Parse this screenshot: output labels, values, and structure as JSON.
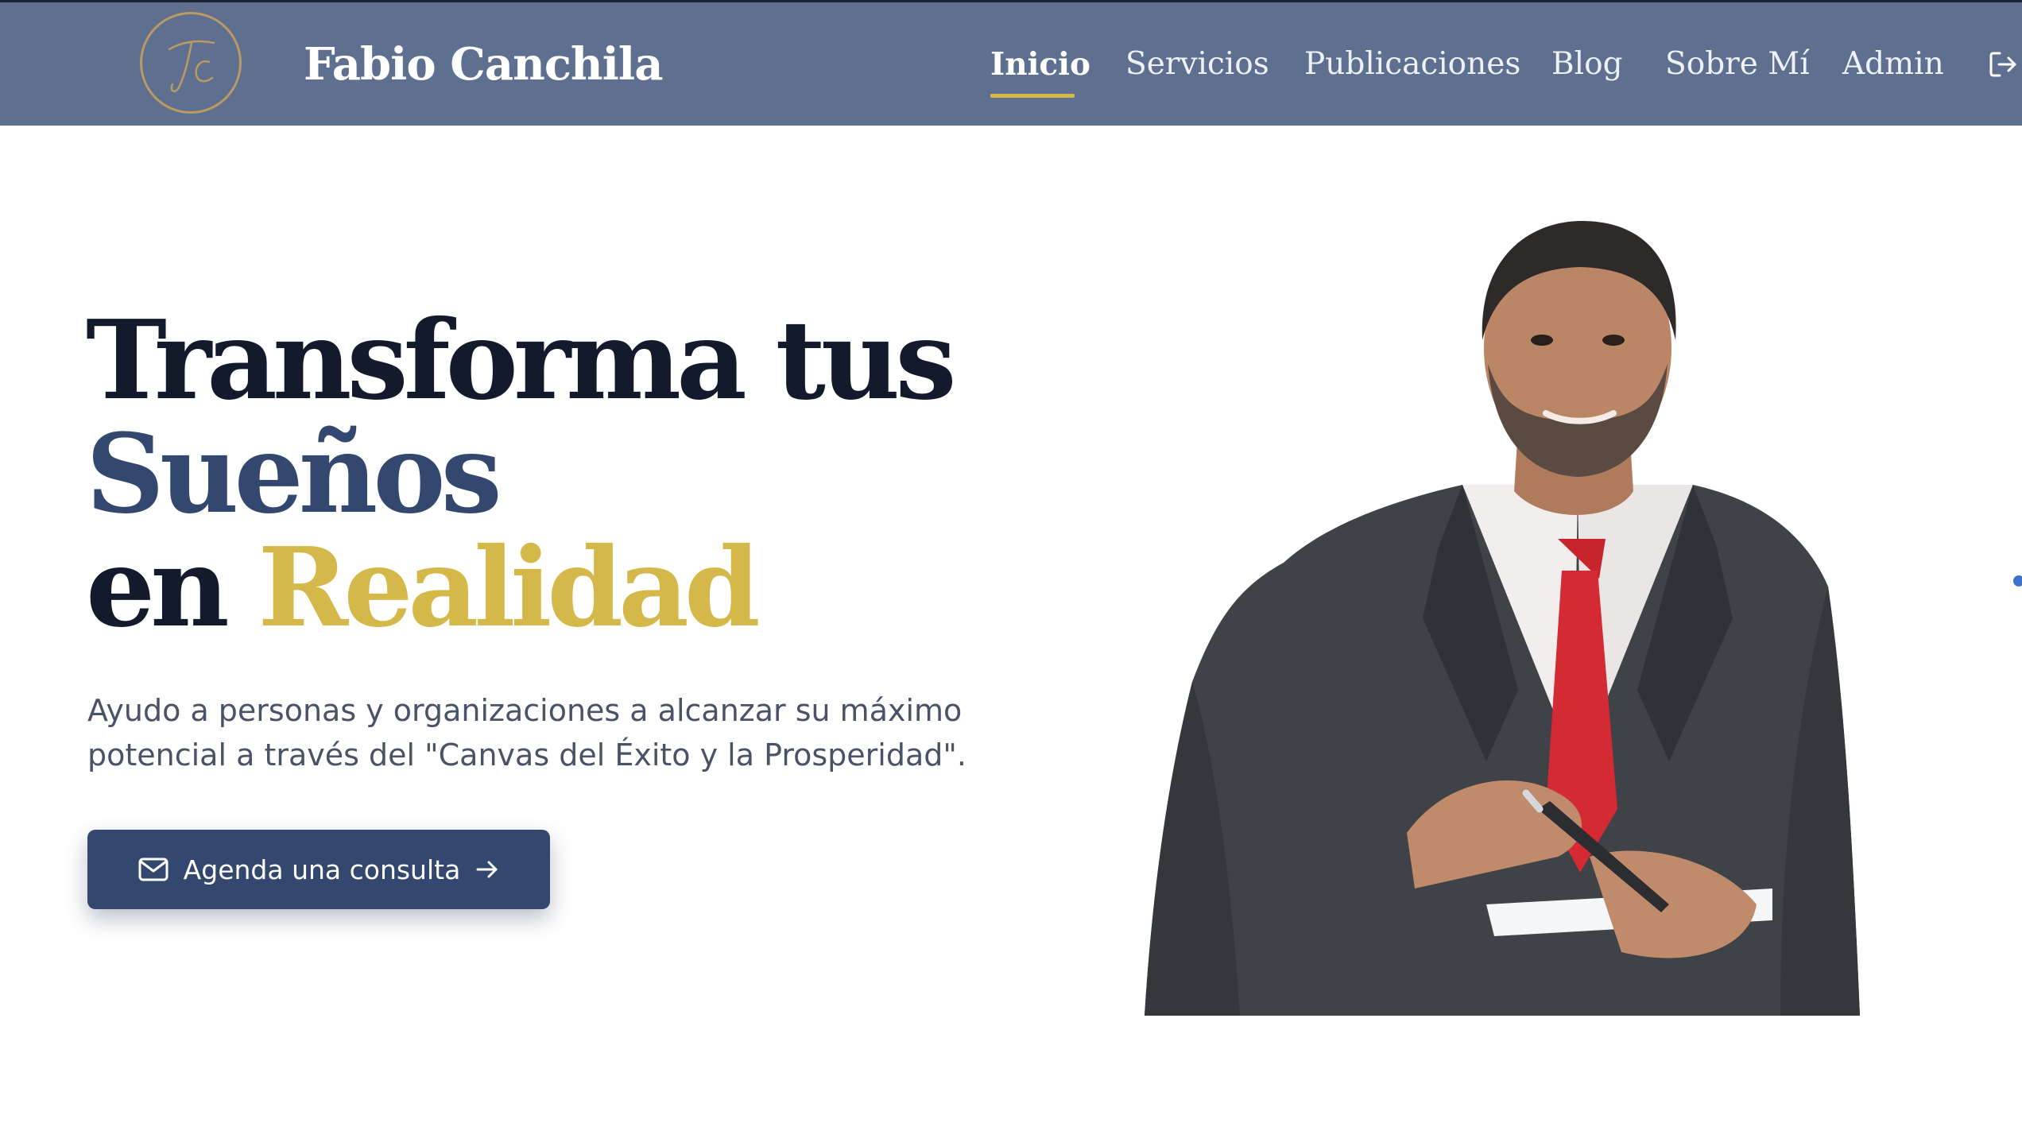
{
  "brand": {
    "name": "Fabio Canchila",
    "logo_icon": "fc-monogram-logo",
    "logo_ring_color": "#b89b62"
  },
  "nav": {
    "items": [
      {
        "label": "Inicio",
        "active": true
      },
      {
        "label": "Servicios"
      },
      {
        "label": "Publicaciones"
      },
      {
        "label": "Blog"
      },
      {
        "label": "Sobre Mí"
      },
      {
        "label": "Admin"
      }
    ],
    "logout_icon": "logout-icon",
    "background": "#5f6f8f",
    "active_underline_color": "#d4b94a"
  },
  "hero": {
    "title_line1": "Transforma tus",
    "title_line2": "Sueños",
    "title_line3_prefix": "en",
    "title_line3_accent": "Realidad",
    "subtitle_line1": "Ayudo a personas y organizaciones a alcanzar su máximo",
    "subtitle_line2": "potencial a través del \"Canvas del Éxito y la Prosperidad\".",
    "cta_label": "Agenda una consulta",
    "cta_icon": "mail-icon",
    "cta_arrow_icon": "arrow-right-icon",
    "colors": {
      "dark": "#121a2b",
      "blue": "#33476f",
      "gold": "#d4b94a"
    }
  },
  "portrait": {
    "subject": "man in grey suit with red tie holding a pen and paper"
  }
}
